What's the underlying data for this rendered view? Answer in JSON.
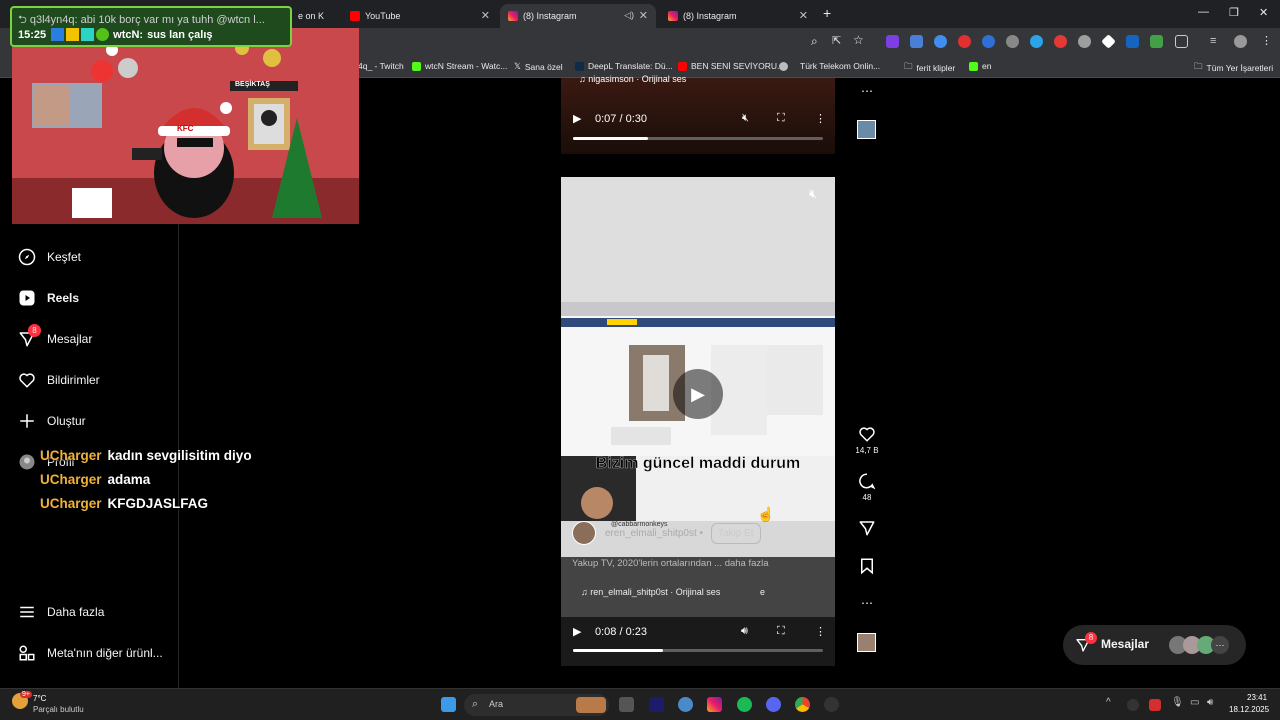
{
  "browser": {
    "tabs": [
      {
        "label": "e on K",
        "close": false
      },
      {
        "label": "YouTube",
        "close": true
      },
      {
        "label": "(8) Instagram",
        "close": true,
        "active": true
      },
      {
        "label": "(8) Instagram",
        "close": true
      }
    ],
    "new_tab": "+",
    "bookmarks": [
      "4q_ - Twitch",
      "wtcN Stream - Watc...",
      "Sana özel",
      "DeepL Translate: Dü...",
      "BEN SENİ SEVİYORU...",
      "Türk Telekom Onlin...",
      "ferit klipler",
      "en",
      "Tüm Yer İşaretleri"
    ]
  },
  "stream_overlay": {
    "chat_line_1": "q3l4yn4q: abi 10k borç var mı ya tuhh @wtcn l...",
    "time": "15:25",
    "chat_user": "wtcN:",
    "chat_msg": "sus lan çalış",
    "scene_sign": "BEŞİKTAŞ",
    "hat_text": "KFC"
  },
  "sidebar": {
    "items": [
      {
        "label": "Keşfet",
        "icon": "compass-icon"
      },
      {
        "label": "Reels",
        "icon": "reels-icon"
      },
      {
        "label": "Mesajlar",
        "icon": "messages-icon",
        "badge": "8"
      },
      {
        "label": "Bildirimler",
        "icon": "heart-icon"
      },
      {
        "label": "Oluştur",
        "icon": "plus-icon"
      },
      {
        "label": "Profil",
        "icon": "profile-icon"
      }
    ],
    "more": "Daha fazla",
    "meta": "Meta'nın diğer ürünl..."
  },
  "chat_overlay": [
    {
      "nick": "UCharger",
      "text": "kadın sevgilisitim diyo"
    },
    {
      "nick": "UCharger",
      "text": "adama"
    },
    {
      "nick": "UCharger",
      "text": "KFGDJASLFAG"
    }
  ],
  "reel_top": {
    "audio": "nigasimson · Orijinal ses",
    "time": "0:07 / 0:30",
    "progress": 0.3
  },
  "reel_main": {
    "caption_overlay": "Bizim güncel maddi durum",
    "author": "eren_elmali_shitp0st",
    "follow": "Takip Et",
    "handle_overlay": "@cabbarmonkeys",
    "description": "Yakup TV, 2020'lerin ortalarından",
    "more": "... daha fazla",
    "audio": "ren_elmali_shitp0st · Orijinal ses",
    "time": "0:08 / 0:23",
    "progress": 0.36
  },
  "actions": {
    "likes": "14,7 B",
    "comments": "48"
  },
  "messages_pill": {
    "label": "Mesajlar",
    "badge": "8"
  },
  "taskbar": {
    "weather_temp": "7°C",
    "weather_desc": "Parçalı bulutlu",
    "search": "Ara",
    "clock": "23:41",
    "date": "18.12.2025",
    "weather_badge": "9+"
  }
}
